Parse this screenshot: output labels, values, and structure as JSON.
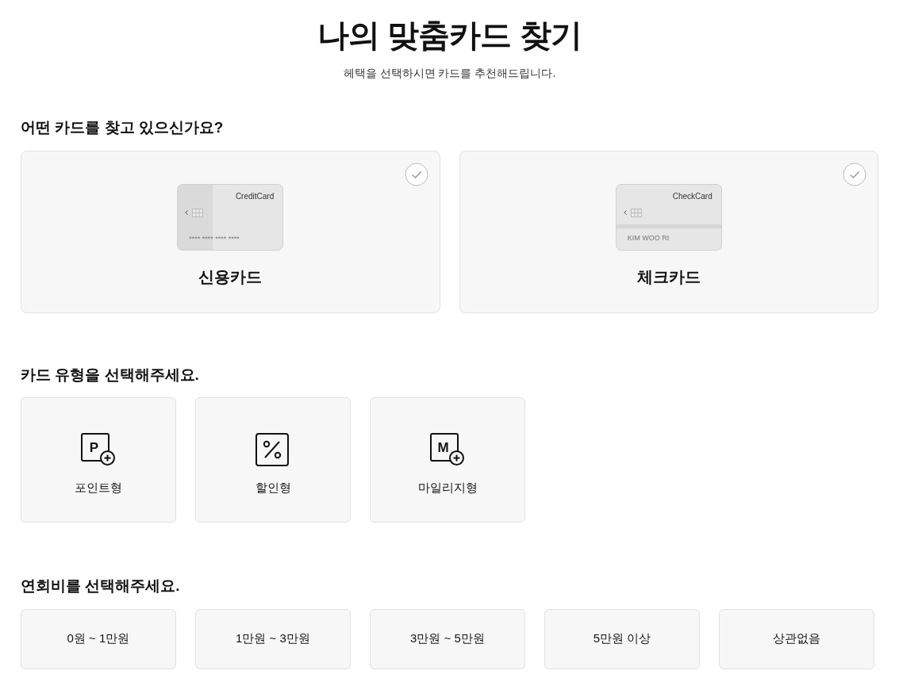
{
  "title": "나의 맞춤카드 찾기",
  "subtitle": "헤택을 선택하시면 카드를 추천해드립니다.",
  "card_section": {
    "heading": "어떤 카드를 찾고 있으신가요?",
    "options": [
      {
        "kind": "credit",
        "label": "신용카드",
        "card_brand": "CreditCard",
        "card_line": "**** **** **** ****",
        "selected": false
      },
      {
        "kind": "check",
        "label": "체크카드",
        "card_brand": "CheckCard",
        "card_line": "KIM WOO RI",
        "selected": false
      }
    ]
  },
  "type_section": {
    "heading": "카드 유형을 선택해주세요.",
    "options": [
      {
        "kind": "letter",
        "icon_text": "P",
        "label": "포인트형",
        "selected": false
      },
      {
        "kind": "percent",
        "label": "할인형",
        "selected": false
      },
      {
        "kind": "letter",
        "icon_text": "M",
        "label": "마일리지형",
        "selected": false
      }
    ]
  },
  "fee_section": {
    "heading": "연회비를 선택해주세요.",
    "options": [
      {
        "label": "0원 ~ 1만원",
        "selected": false
      },
      {
        "label": "1만원 ~ 3만원",
        "selected": false
      },
      {
        "label": "3만원 ~ 5만원",
        "selected": false
      },
      {
        "label": "5만원 이상",
        "selected": false
      },
      {
        "label": "상관없음",
        "selected": false
      }
    ]
  }
}
